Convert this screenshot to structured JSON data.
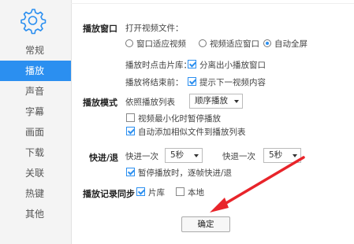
{
  "sidebar": {
    "items": [
      {
        "label": "常规"
      },
      {
        "label": "播放"
      },
      {
        "label": "声音"
      },
      {
        "label": "字幕"
      },
      {
        "label": "画面"
      },
      {
        "label": "下载"
      },
      {
        "label": "关联"
      },
      {
        "label": "热键"
      },
      {
        "label": "其他"
      }
    ],
    "active_index": 1
  },
  "playback_window": {
    "title": "播放窗口",
    "open_video_label": "打开视频文件：",
    "options": [
      "窗口适应视频",
      "视频适应窗口",
      "自动全屏"
    ],
    "selected": "自动全屏",
    "click_library_label": "播放时点击片库：",
    "click_library_option": {
      "label": "分离出小播放窗口",
      "checked": true
    },
    "end_label": "播放将结束前：",
    "end_option": {
      "label": "提示下一视频内容",
      "checked": true
    }
  },
  "playback_mode": {
    "title": "播放模式",
    "order_label": "依照播放列表",
    "order_value": "顺序播放",
    "minimize_pause": {
      "label": "视频最小化时暂停播放",
      "checked": false
    },
    "auto_add": {
      "label": "自动添加相似文件到播放列表",
      "checked": true
    }
  },
  "seek": {
    "title": "快进/退",
    "forward_label": "快进一次",
    "forward_value": "5秒",
    "backward_label": "快退一次",
    "backward_value": "5秒",
    "pause_frame": {
      "label": "暂停播放时，逐帧快进/退",
      "checked": true
    }
  },
  "history": {
    "title": "播放记录同步",
    "library": {
      "label": "片库",
      "checked": true
    },
    "local": {
      "label": "本地",
      "checked": false
    }
  },
  "footer": {
    "confirm_label": "确定"
  },
  "colors": {
    "accent": "#2b8ff0",
    "arrow": "#e8242a"
  }
}
